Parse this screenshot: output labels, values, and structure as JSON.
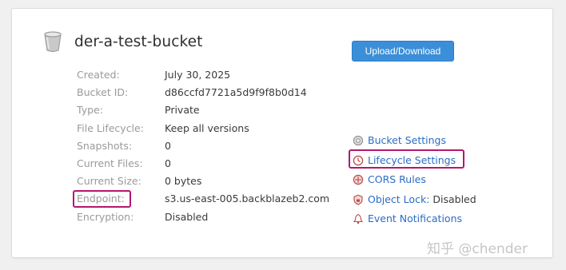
{
  "bucket": {
    "name": "der-a-test-bucket",
    "icon": "bucket-icon"
  },
  "upload_button": {
    "label": "Upload/Download"
  },
  "properties": [
    {
      "label": "Created:",
      "value": "July 30, 2025"
    },
    {
      "label": "Bucket ID:",
      "value": "d86ccfd7721a5d9f9f8b0d14"
    },
    {
      "label": "Type:",
      "value": "Private"
    },
    {
      "label": "File Lifecycle:",
      "value": "Keep all versions"
    },
    {
      "label": "Snapshots:",
      "value": "0"
    },
    {
      "label": "Current Files:",
      "value": "0"
    },
    {
      "label": "Current Size:",
      "value": "0 bytes"
    },
    {
      "label": "Endpoint:",
      "value": "s3.us-east-005.backblazeb2.com"
    },
    {
      "label": "Encryption:",
      "value": "Disabled"
    }
  ],
  "links": {
    "bucket_settings": {
      "label": "Bucket Settings",
      "icon": "gear-icon"
    },
    "lifecycle_settings": {
      "label": "Lifecycle Settings",
      "icon": "clock-cycle-icon"
    },
    "cors_rules": {
      "label": "CORS Rules",
      "icon": "cors-shield-icon"
    },
    "object_lock": {
      "label": "Object Lock:",
      "status": " Disabled",
      "icon": "lock-shield-icon"
    },
    "event_notifications": {
      "label": "Event Notifications",
      "icon": "bell-icon"
    }
  },
  "highlight_color": "#b5166e",
  "link_color": "#2b6cc4",
  "button_color": "#3b8fd9",
  "watermark": "知乎 @chender"
}
